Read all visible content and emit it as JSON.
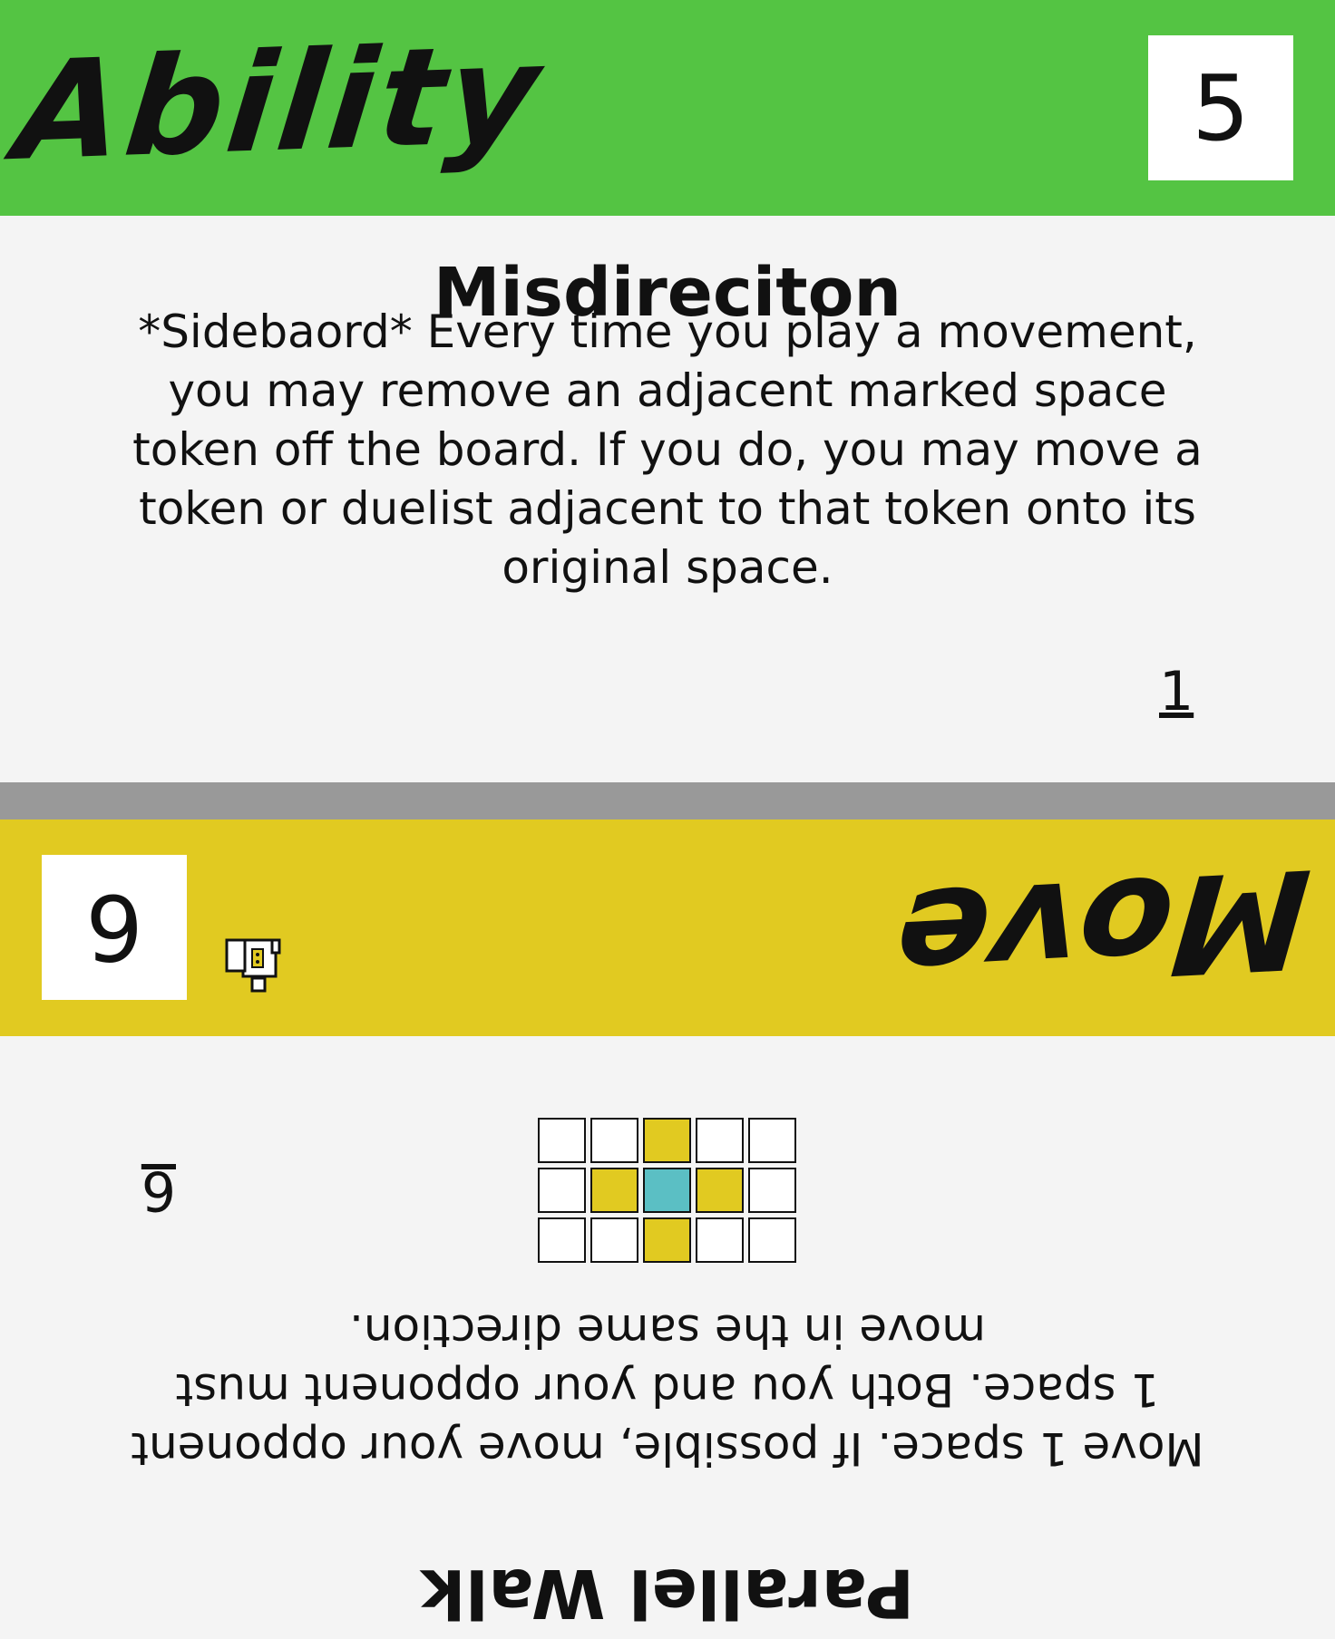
{
  "top_card": {
    "type_label": "Ability",
    "cost": "5",
    "name": "Misdireciton",
    "text": "*Sidebaord* Every time you play a movement, you may remove an adjacent marked space token off the board. If you do, you may move a token or duelist adjacent to that token onto its original space.",
    "number": "1",
    "banner_color": "#54c443"
  },
  "bottom_card": {
    "type_label": "Move",
    "cost": "6",
    "name": "Parallel Walk",
    "text": "Move 1 space. If possible, move your opponent 1 space. Both you and your opponent must move in the same direction.",
    "number": "6",
    "banner_color": "#e1ca21",
    "icon": "duelist-icon",
    "grid": [
      [
        "empty",
        "empty",
        "move",
        "empty",
        "empty"
      ],
      [
        "empty",
        "move",
        "self",
        "move",
        "empty"
      ],
      [
        "empty",
        "empty",
        "move",
        "empty",
        "empty"
      ]
    ]
  }
}
